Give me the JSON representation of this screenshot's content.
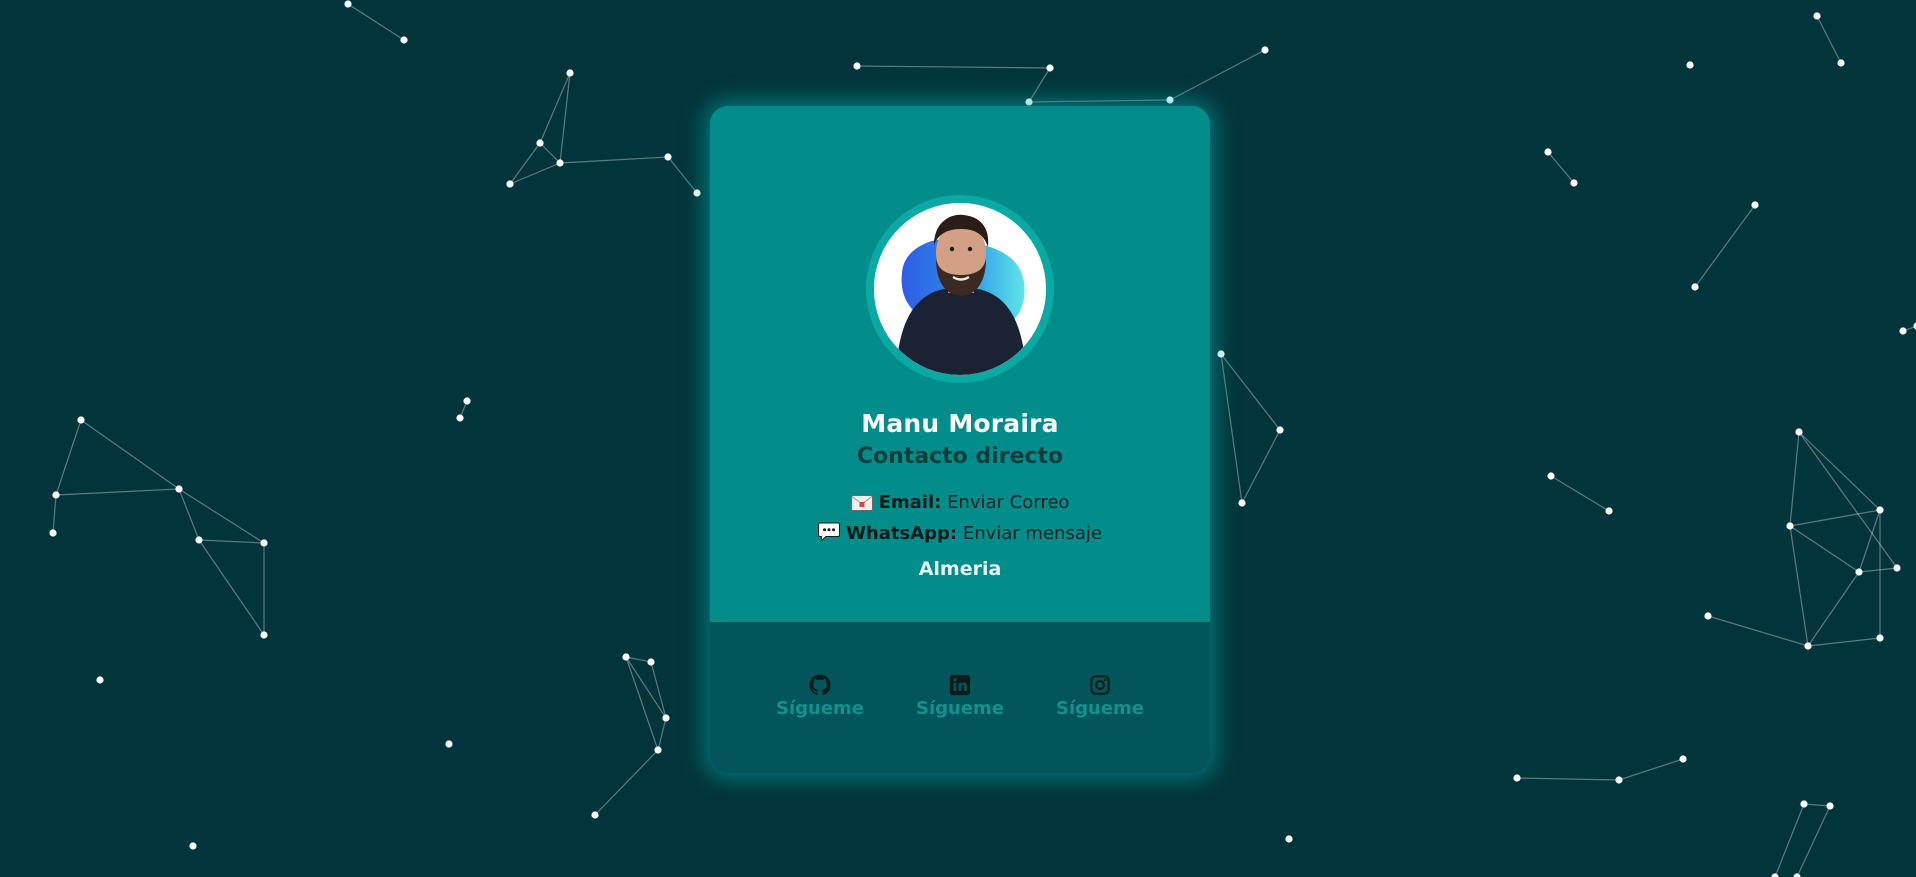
{
  "profile": {
    "name": "Manu Moraira",
    "subtitle": "Contacto directo",
    "location": "Almeria"
  },
  "contacts": {
    "email": {
      "icon": "envelope-icon",
      "label": "Email:",
      "value": "Enviar Correo"
    },
    "whatsapp": {
      "icon": "speech-bubble-icon",
      "label": "WhatsApp:",
      "value": "Enviar mensaje"
    }
  },
  "social": {
    "github": {
      "icon": "github-icon",
      "label": "Sígueme"
    },
    "linkedin": {
      "icon": "linkedin-icon",
      "label": "Sígueme"
    },
    "instagram": {
      "icon": "instagram-icon",
      "label": "Sígueme"
    }
  },
  "colors": {
    "background": "#02353b",
    "card_top": "#028d8b",
    "card_bottom": "#02555a",
    "glow": "#00aaaa",
    "particle": "#ffffff"
  }
}
